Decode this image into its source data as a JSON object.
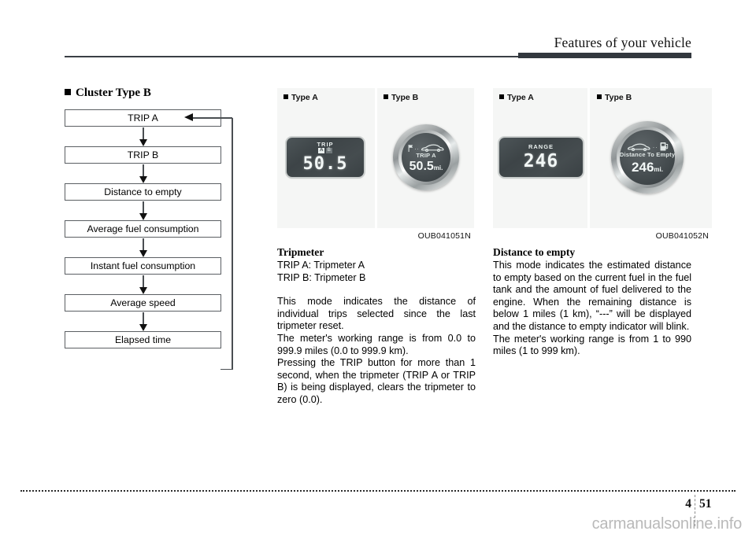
{
  "header": {
    "title": "Features of your vehicle"
  },
  "left_column": {
    "heading": "Cluster Type B",
    "flow_items": [
      "TRIP A",
      "TRIP B",
      "Distance to empty",
      "Average fuel consumption",
      "Instant fuel consumption",
      "Average speed",
      "Elapsed time"
    ]
  },
  "figures": [
    {
      "code": "OUB041051N",
      "type_a_label": "Type A",
      "type_b_label": "Type B",
      "lcd": {
        "label": "TRIP",
        "indicator_a": "A",
        "indicator_b": "B",
        "value": "50.5"
      },
      "gauge": {
        "icon": "car-icon",
        "sub_label": "TRIP A",
        "value": "50.5",
        "unit": "mi."
      }
    },
    {
      "code": "OUB041052N",
      "type_a_label": "Type A",
      "type_b_label": "Type B",
      "lcd": {
        "label": "RANGE",
        "value": "246"
      },
      "gauge": {
        "icon": "car-to-fuel-pump-icon",
        "sub_label": "Distance To Empty",
        "value": "246",
        "unit": "mi."
      }
    }
  ],
  "middle_column": {
    "heading": "Tripmeter",
    "line_a": "TRIP A: Tripmeter A",
    "line_b": "TRIP B: Tripmeter B",
    "para1": "This mode indicates the distance of individual trips selected since the last tripmeter reset.",
    "para2": "The meter's working range is from 0.0 to 999.9 miles (0.0 to 999.9 km).",
    "para3": "Pressing the TRIP button for more than 1 second, when the tripmeter (TRIP A or TRIP B) is being displayed, clears the tripmeter to zero (0.0)."
  },
  "right_column": {
    "heading": "Distance to empty",
    "para1": "This mode indicates the estimated distance to empty based on the current fuel in the fuel tank and the amount of fuel delivered to the engine. When the remaining distance is below 1 miles (1 km), “---” will be displayed and the distance to empty indicator will blink.",
    "para2": "The meter's working range is from 1 to 990 miles (1 to 999 km)."
  },
  "footer": {
    "chapter": "4",
    "page": "51",
    "watermark": "carmanualsonline.info"
  }
}
